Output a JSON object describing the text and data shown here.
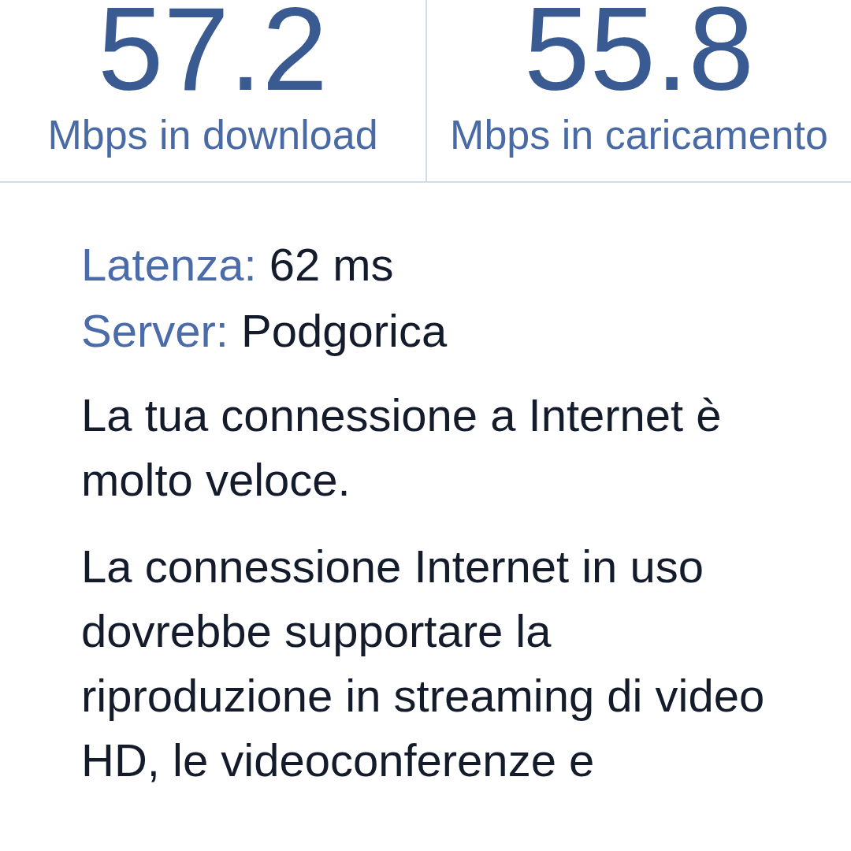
{
  "results": [
    {
      "value": "57.2",
      "label": "Mbps in download"
    },
    {
      "value": "55.8",
      "label": "Mbps in caricamento"
    }
  ],
  "details": [
    {
      "label": "Latenza:",
      "value": "62 ms"
    },
    {
      "label": "Server:",
      "value": "Podgorica"
    }
  ],
  "paragraphs": [
    "La tua connessione a Internet è molto veloce.",
    "La connessione Internet in uso dovrebbe supportare la riproduzione in streaming di video HD, le videoconferenze e"
  ]
}
